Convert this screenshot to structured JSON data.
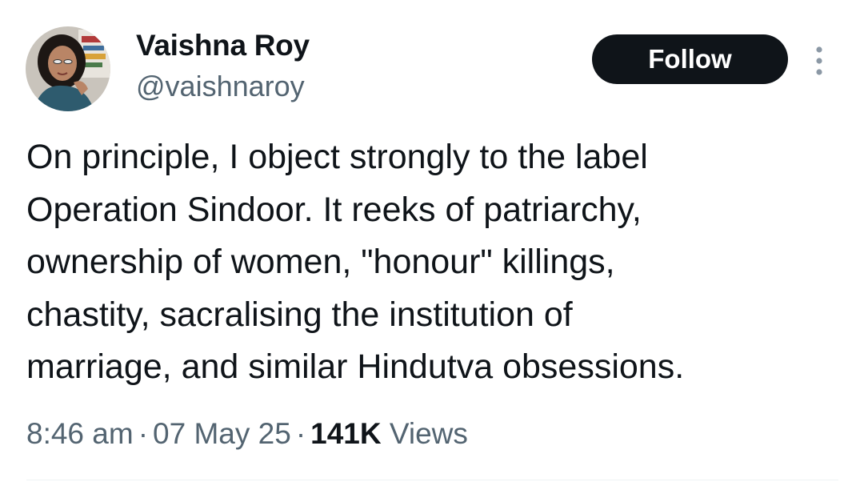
{
  "author": {
    "display_name": "Vaishna Roy",
    "handle": "@vaishnaroy"
  },
  "actions": {
    "follow_label": "Follow",
    "more_icon": "more-vertical-icon"
  },
  "tweet": {
    "lines": [
      "On principle, I object strongly to the label",
      "Operation Sindoor. It reeks of patriarchy,",
      "ownership of women, \"honour\" killings,",
      "chastity, sacralising the institution of",
      "marriage, and similar Hindutva obsessions."
    ]
  },
  "meta": {
    "time": "8:46 am",
    "separator": "·",
    "date": "07 May 25",
    "views_count": "141K",
    "views_label": "Views"
  },
  "colors": {
    "text_primary": "#0f1419",
    "text_secondary": "#536471",
    "button_bg": "#0f1419",
    "button_text": "#ffffff",
    "divider": "#eff3f4"
  }
}
